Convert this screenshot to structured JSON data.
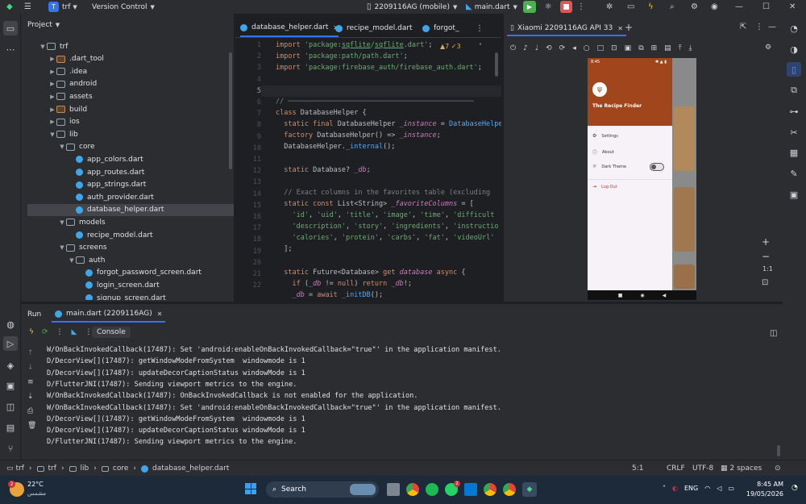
{
  "topbar": {
    "project_badge": "T",
    "project_name": "trf",
    "vcs": "Version Control",
    "device": "2209116AG (mobile)",
    "run_config": "main.dart"
  },
  "project_panel": {
    "title": "Project",
    "tree": [
      {
        "label": "trf",
        "type": "folder",
        "depth": 0,
        "expanded": true
      },
      {
        "label": ".dart_tool",
        "type": "folder-orange",
        "depth": 1,
        "expanded": false
      },
      {
        "label": ".idea",
        "type": "folder",
        "depth": 1,
        "expanded": false
      },
      {
        "label": "android",
        "type": "folder",
        "depth": 1,
        "expanded": false
      },
      {
        "label": "assets",
        "type": "folder",
        "depth": 1,
        "expanded": false
      },
      {
        "label": "build",
        "type": "folder-orange",
        "depth": 1,
        "expanded": false
      },
      {
        "label": "ios",
        "type": "folder",
        "depth": 1,
        "expanded": false
      },
      {
        "label": "lib",
        "type": "folder",
        "depth": 1,
        "expanded": true
      },
      {
        "label": "core",
        "type": "folder",
        "depth": 2,
        "expanded": true
      },
      {
        "label": "app_colors.dart",
        "type": "dart",
        "depth": 3
      },
      {
        "label": "app_routes.dart",
        "type": "dart",
        "depth": 3
      },
      {
        "label": "app_strings.dart",
        "type": "dart",
        "depth": 3
      },
      {
        "label": "auth_provider.dart",
        "type": "dart",
        "depth": 3
      },
      {
        "label": "database_helper.dart",
        "type": "dart",
        "depth": 3,
        "selected": true
      },
      {
        "label": "models",
        "type": "folder",
        "depth": 2,
        "expanded": true
      },
      {
        "label": "recipe_model.dart",
        "type": "dart",
        "depth": 3
      },
      {
        "label": "screens",
        "type": "folder",
        "depth": 2,
        "expanded": true
      },
      {
        "label": "auth",
        "type": "folder",
        "depth": 3,
        "expanded": true
      },
      {
        "label": "forgot_password_screen.dart",
        "type": "dart",
        "depth": 4
      },
      {
        "label": "login_screen.dart",
        "type": "dart",
        "depth": 4
      },
      {
        "label": "signup_screen.dart",
        "type": "dart",
        "depth": 4
      }
    ]
  },
  "editor": {
    "tabs": [
      "database_helper.dart",
      "recipe_model.dart",
      "forgot_"
    ],
    "warnings": "▲7 ✓3",
    "line_numbers": [
      "1",
      "2",
      "3",
      "4",
      "5",
      "6",
      "7",
      "8",
      "9",
      "10",
      "11",
      "12",
      "13",
      "14",
      "15",
      "16",
      "17",
      "18",
      "19",
      "20",
      "21",
      "22"
    ]
  },
  "emulator": {
    "tab_title": "Xiaomi 2209116AG API 33",
    "status_time": "8:45",
    "drawer_title": "The Recipe Finder",
    "menu": [
      "Settings",
      "About",
      "Dark Theme",
      "Log Out"
    ],
    "zoom_label": "1:1"
  },
  "run_panel": {
    "title": "Run",
    "session_tab": "main.dart (2209116AG)",
    "console_label": "Console",
    "logs": [
      "W/OnBackInvokedCallback(17487): Set 'android:enableOnBackInvokedCallback=\"true\"' in the application manifest.",
      "D/DecorView[](17487): getWindowModeFromSystem  windowmode is 1",
      "D/DecorView[](17487): updateDecorCaptionStatus windowMode is 1",
      "D/FlutterJNI(17487): Sending viewport metrics to the engine.",
      "W/OnBackInvokedCallback(17487): OnBackInvokedCallback is not enabled for the application.",
      "W/OnBackInvokedCallback(17487): Set 'android:enableOnBackInvokedCallback=\"true\"' in the application manifest.",
      "D/DecorView[](17487): getWindowModeFromSystem  windowmode is 1",
      "D/DecorView[](17487): updateDecorCaptionStatus windowMode is 1",
      "D/FlutterJNI(17487): Sending viewport metrics to the engine."
    ]
  },
  "statusbar": {
    "breadcrumb": [
      "trf",
      "trf",
      "lib",
      "core",
      "database_helper.dart"
    ],
    "position": "5:1",
    "line_sep": "CRLF",
    "encoding": "UTF-8",
    "indent": "2 spaces"
  },
  "taskbar": {
    "weather_temp": "22°C",
    "weather_desc": "مشمس",
    "weather_badge": "2",
    "search_label": "Search",
    "lang": "ENG",
    "time": "8:45 AM",
    "date": "19/05/2026",
    "whatsapp_badge": "2"
  },
  "colors": {
    "accent": "#3574f0",
    "drawer_header": "#a0451c",
    "run_green": "#4caf50",
    "stop_red": "#e05555"
  }
}
